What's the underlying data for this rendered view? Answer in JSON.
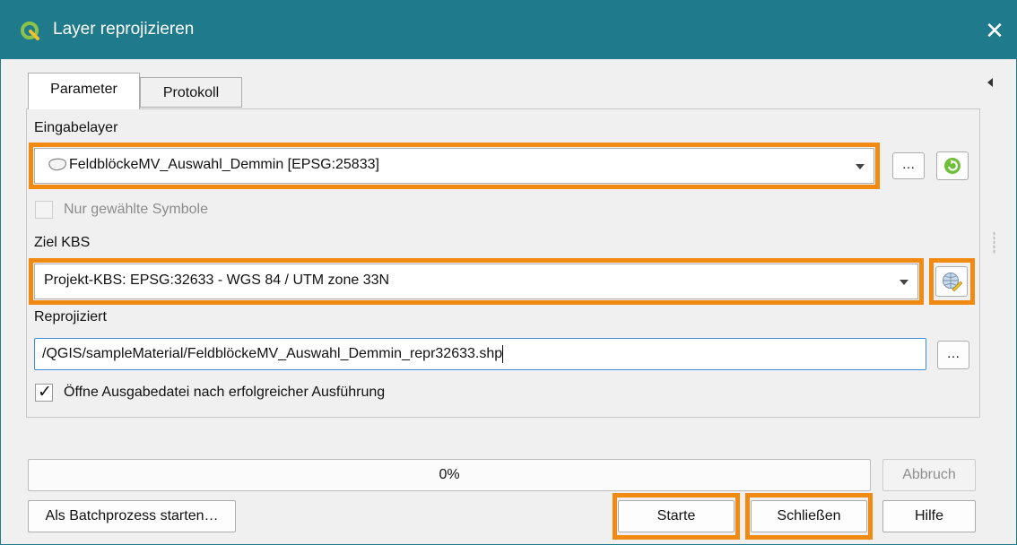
{
  "window": {
    "title": "Layer reprojizieren",
    "close_glyph": "✕",
    "icon": "qgis-logo-icon"
  },
  "tabs": [
    {
      "label": "Parameter",
      "active": true
    },
    {
      "label": "Protokoll",
      "active": false
    }
  ],
  "params": {
    "input_label": "Eingabelayer",
    "input_value": "FeldblöckeMV_Auswahl_Demmin [EPSG:25833]",
    "input_browse_label": "…",
    "selected_only_label": "Nur gewählte Symbole",
    "selected_only_checked": false,
    "target_label": "Ziel KBS",
    "target_value": "Projekt-KBS: EPSG:32633 - WGS 84 / UTM zone 33N",
    "output_label": "Reprojiziert",
    "output_value": "/QGIS/sampleMaterial/FeldblöckeMV_Auswahl_Demmin_repr32633.shp",
    "output_browse_label": "…",
    "open_output_label": "Öffne Ausgabedatei nach erfolgreicher Ausführung",
    "open_output_checked": true
  },
  "progress": {
    "value": 0,
    "text": "0%"
  },
  "buttons": {
    "cancel": "Abbruch",
    "batch": "Als Batchprozess starten…",
    "run": "Starte",
    "close": "Schließen",
    "help": "Hilfe"
  },
  "colors": {
    "titlebar": "#1f7a8c",
    "highlight": "#f08a12",
    "focus_border": "#3c8ed8"
  }
}
